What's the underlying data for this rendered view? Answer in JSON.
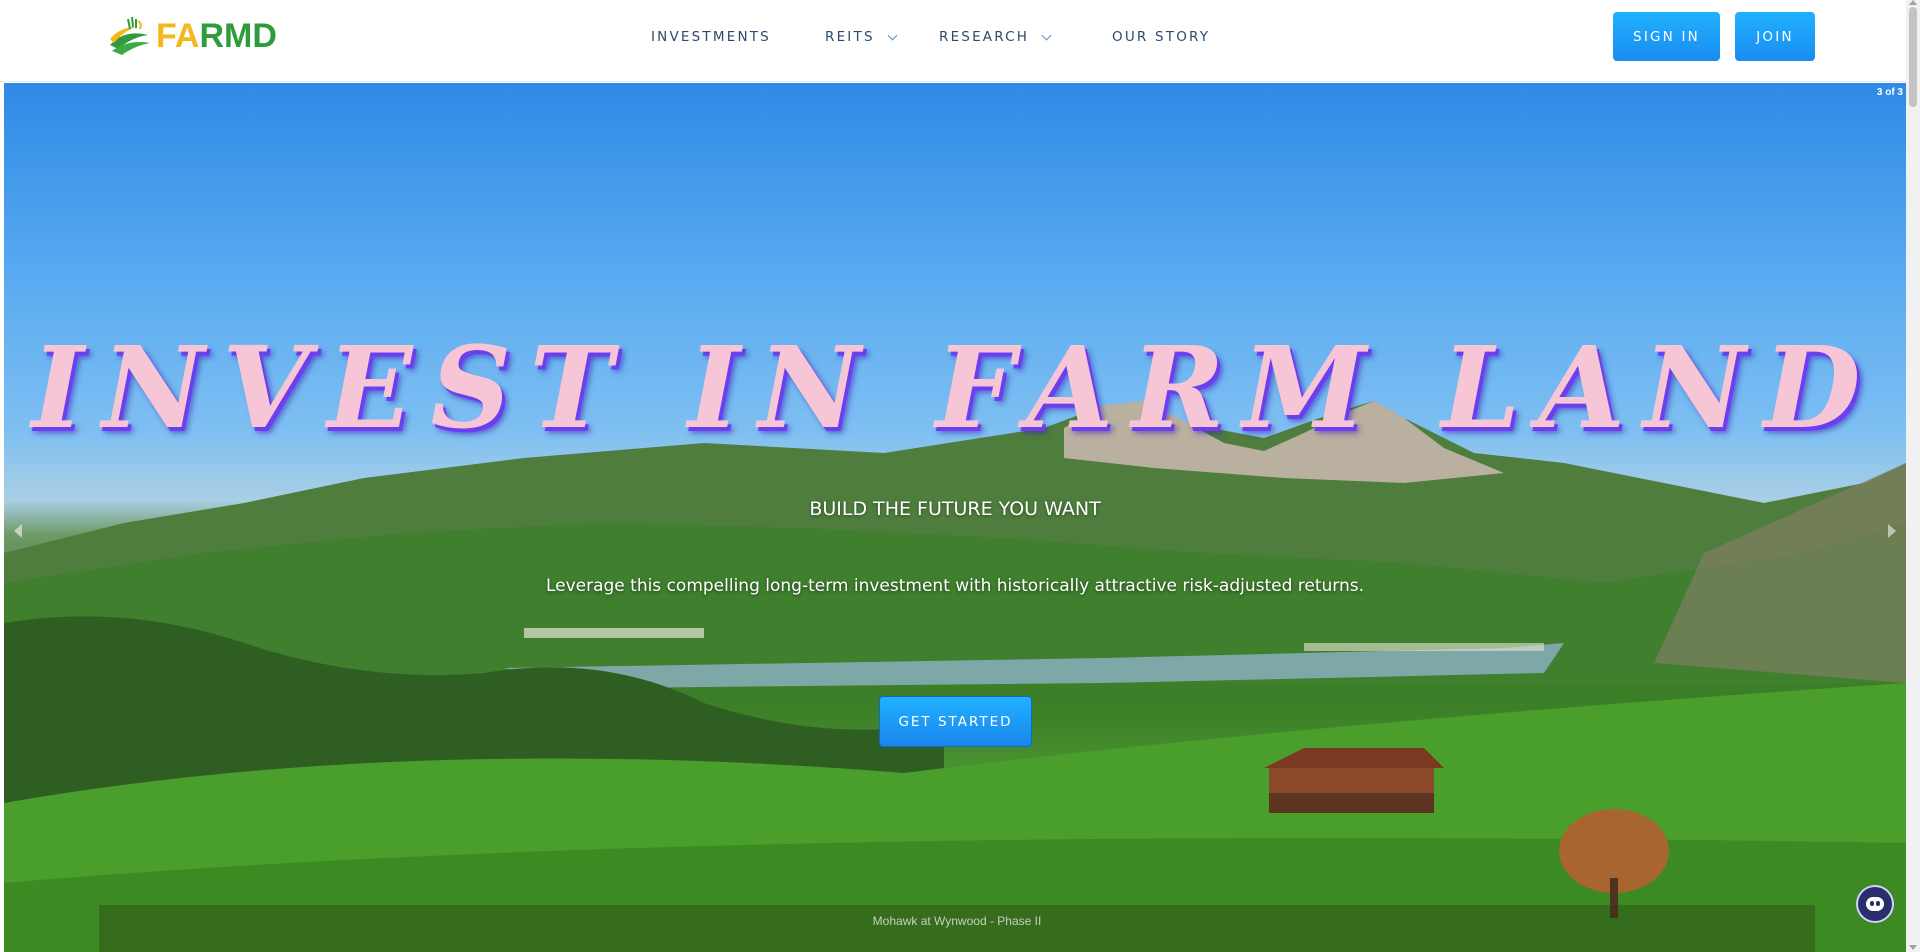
{
  "header": {
    "logo_text_part1": "FA",
    "logo_text_part2": "RMD",
    "logo_icon": "farm-field-icon",
    "nav": [
      {
        "label": "INVESTMENTS",
        "has_dropdown": false
      },
      {
        "label": "REITS",
        "has_dropdown": true
      },
      {
        "label": "RESEARCH",
        "has_dropdown": true
      },
      {
        "label": "OUR STORY",
        "has_dropdown": false
      }
    ],
    "sign_in_label": "SIGN IN",
    "join_label": "JOIN"
  },
  "hero": {
    "slide_counter": "3 of 3",
    "headline": "INVEST IN FARM LAND",
    "subheading": "BUILD THE FUTURE YOU WANT",
    "tagline": "Leverage this compelling long-term investment with historically attractive risk-adjusted returns.",
    "cta_label": "GET STARTED",
    "caption": "Mohawk at Wynwood - Phase II"
  },
  "colors": {
    "accent_blue": "#1a8cf0",
    "logo_yellow": "#f3b81c",
    "logo_green": "#2f9b3b",
    "nav_text": "#2c4a6b",
    "headline_pink": "#f7c6d6"
  },
  "icons": {
    "prev_arrow": "chevron-left-icon",
    "next_arrow": "chevron-right-icon",
    "chat": "chatbot-icon",
    "dropdown": "chevron-down-icon"
  }
}
